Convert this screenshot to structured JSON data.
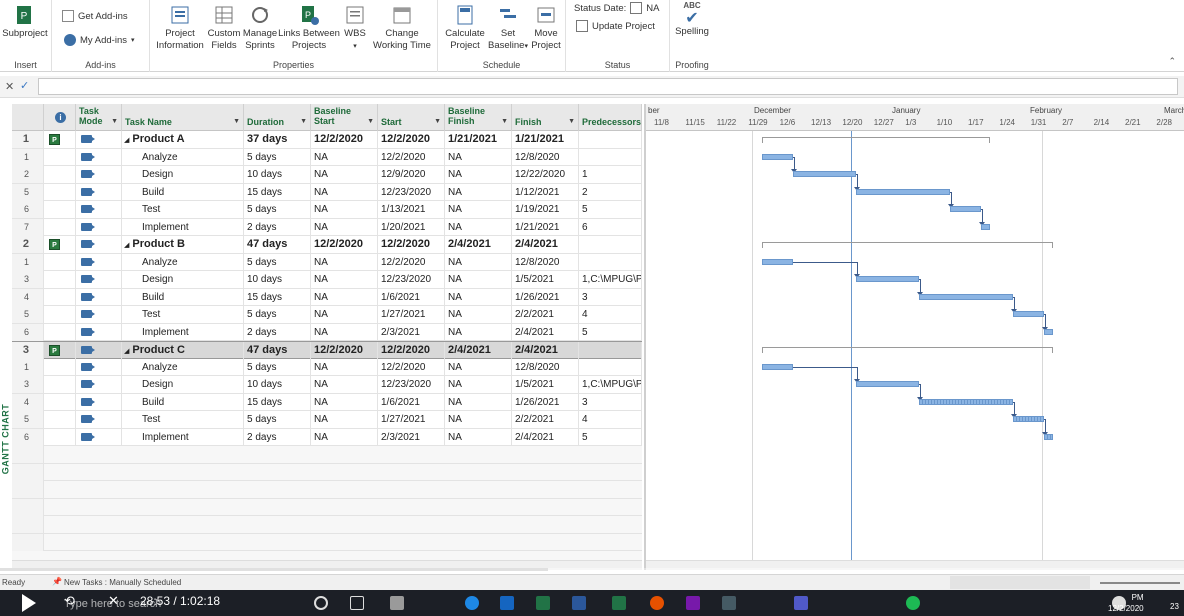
{
  "ribbon": {
    "insert": {
      "subproject": "Subproject",
      "group": "Insert"
    },
    "addins": {
      "get": "Get Add-ins",
      "my": "My Add-ins",
      "group": "Add-ins"
    },
    "properties": {
      "project_info": [
        "Project",
        "Information"
      ],
      "custom_fields": [
        "Custom",
        "Fields"
      ],
      "manage_sprints": [
        "Manage",
        "Sprints"
      ],
      "links_between": [
        "Links Between",
        "Projects"
      ],
      "wbs": "WBS",
      "change_working": [
        "Change",
        "Working Time"
      ],
      "group": "Properties"
    },
    "schedule": {
      "calculate": [
        "Calculate",
        "Project"
      ],
      "set_baseline": [
        "Set",
        "Baseline"
      ],
      "move": [
        "Move",
        "Project"
      ],
      "group": "Schedule"
    },
    "status": {
      "status_date_label": "Status Date:",
      "status_date_value": "NA",
      "update": "Update Project",
      "group": "Status"
    },
    "proofing": {
      "abc": "ABC",
      "spelling": "Spelling",
      "group": "Proofing"
    }
  },
  "side_label": "GANTT CHART",
  "columns": {
    "mode": [
      "Task",
      "Mode"
    ],
    "name": "Task Name",
    "duration": "Duration",
    "baseline_start": [
      "Baseline",
      "Start"
    ],
    "start": "Start",
    "baseline_finish": [
      "Baseline",
      "Finish"
    ],
    "finish": "Finish",
    "predecessors": "Predecessors"
  },
  "rows": [
    {
      "id": "1",
      "summary": true,
      "name": "Product A",
      "duration": "37 days",
      "bstart": "12/2/2020",
      "start": "12/2/2020",
      "bfinish": "1/21/2021",
      "finish": "1/21/2021",
      "pred": ""
    },
    {
      "id": "1",
      "summary": false,
      "name": "Analyze",
      "duration": "5 days",
      "bstart": "NA",
      "start": "12/2/2020",
      "bfinish": "NA",
      "finish": "12/8/2020",
      "pred": ""
    },
    {
      "id": "2",
      "summary": false,
      "name": "Design",
      "duration": "10 days",
      "bstart": "NA",
      "start": "12/9/2020",
      "bfinish": "NA",
      "finish": "12/22/2020",
      "pred": "1"
    },
    {
      "id": "5",
      "summary": false,
      "name": "Build",
      "duration": "15 days",
      "bstart": "NA",
      "start": "12/23/2020",
      "bfinish": "NA",
      "finish": "1/12/2021",
      "pred": "2"
    },
    {
      "id": "6",
      "summary": false,
      "name": "Test",
      "duration": "5 days",
      "bstart": "NA",
      "start": "1/13/2021",
      "bfinish": "NA",
      "finish": "1/19/2021",
      "pred": "5"
    },
    {
      "id": "7",
      "summary": false,
      "name": "Implement",
      "duration": "2 days",
      "bstart": "NA",
      "start": "1/20/2021",
      "bfinish": "NA",
      "finish": "1/21/2021",
      "pred": "6"
    },
    {
      "id": "2",
      "summary": true,
      "name": "Product B",
      "duration": "47 days",
      "bstart": "12/2/2020",
      "start": "12/2/2020",
      "bfinish": "2/4/2021",
      "finish": "2/4/2021",
      "pred": ""
    },
    {
      "id": "1",
      "summary": false,
      "name": "Analyze",
      "duration": "5 days",
      "bstart": "NA",
      "start": "12/2/2020",
      "bfinish": "NA",
      "finish": "12/8/2020",
      "pred": ""
    },
    {
      "id": "3",
      "summary": false,
      "name": "Design",
      "duration": "10 days",
      "bstart": "NA",
      "start": "12/23/2020",
      "bfinish": "NA",
      "finish": "1/5/2021",
      "pred": "1,C:\\MPUG\\P"
    },
    {
      "id": "4",
      "summary": false,
      "name": "Build",
      "duration": "15 days",
      "bstart": "NA",
      "start": "1/6/2021",
      "bfinish": "NA",
      "finish": "1/26/2021",
      "pred": "3"
    },
    {
      "id": "5",
      "summary": false,
      "name": "Test",
      "duration": "5 days",
      "bstart": "NA",
      "start": "1/27/2021",
      "bfinish": "NA",
      "finish": "2/2/2021",
      "pred": "4"
    },
    {
      "id": "6",
      "summary": false,
      "name": "Implement",
      "duration": "2 days",
      "bstart": "NA",
      "start": "2/3/2021",
      "bfinish": "NA",
      "finish": "2/4/2021",
      "pred": "5"
    },
    {
      "id": "3",
      "summary": true,
      "selected": true,
      "name": "Product C",
      "duration": "47 days",
      "bstart": "12/2/2020",
      "start": "12/2/2020",
      "bfinish": "2/4/2021",
      "finish": "2/4/2021",
      "pred": ""
    },
    {
      "id": "1",
      "summary": false,
      "name": "Analyze",
      "duration": "5 days",
      "bstart": "NA",
      "start": "12/2/2020",
      "bfinish": "NA",
      "finish": "12/8/2020",
      "pred": ""
    },
    {
      "id": "3",
      "summary": false,
      "name": "Design",
      "duration": "10 days",
      "bstart": "NA",
      "start": "12/23/2020",
      "bfinish": "NA",
      "finish": "1/5/2021",
      "pred": "1,C:\\MPUG\\P"
    },
    {
      "id": "4",
      "summary": false,
      "name": "Build",
      "duration": "15 days",
      "bstart": "NA",
      "start": "1/6/2021",
      "bfinish": "NA",
      "finish": "1/26/2021",
      "pred": "3"
    },
    {
      "id": "5",
      "summary": false,
      "name": "Test",
      "duration": "5 days",
      "bstart": "NA",
      "start": "1/27/2021",
      "bfinish": "NA",
      "finish": "2/2/2021",
      "pred": "4"
    },
    {
      "id": "6",
      "summary": false,
      "name": "Implement",
      "duration": "2 days",
      "bstart": "NA",
      "start": "2/3/2021",
      "bfinish": "NA",
      "finish": "2/4/2021",
      "pred": "5"
    }
  ],
  "timescale": {
    "months": [
      "ber",
      "December",
      "January",
      "February",
      "March"
    ],
    "weeks": [
      "11/8",
      "11/15",
      "11/22",
      "11/29",
      "12/6",
      "12/13",
      "12/20",
      "12/27",
      "1/3",
      "1/10",
      "1/17",
      "1/24",
      "1/31",
      "2/7",
      "2/14",
      "2/21",
      "2/28"
    ]
  },
  "statusbar": {
    "ready": "Ready",
    "mode": "New Tasks : Manually Scheduled"
  },
  "video": {
    "time": "28:53 / 1:02:18",
    "progress": 0.463
  },
  "taskbar": {
    "search": "Type here to search",
    "clock_time": "PM",
    "clock_date": "12/2/2020",
    "badge": "23"
  }
}
